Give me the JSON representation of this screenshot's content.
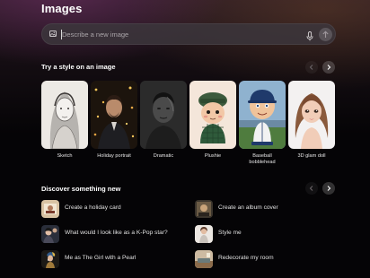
{
  "page": {
    "title": "Images"
  },
  "prompt": {
    "placeholder": "Describe a new image"
  },
  "styles_section": {
    "heading": "Try a style on an image",
    "items": [
      {
        "label": "Sketch"
      },
      {
        "label": "Holiday portrait"
      },
      {
        "label": "Dramatic"
      },
      {
        "label": "Plushie"
      },
      {
        "label": "Baseball bobblehead"
      },
      {
        "label": "3D glam doll"
      }
    ]
  },
  "discover_section": {
    "heading": "Discover something new",
    "items": [
      {
        "label": "Create a holiday card"
      },
      {
        "label": "Create an album cover"
      },
      {
        "label": "What would I look like as a K-Pop star?"
      },
      {
        "label": "Style me"
      },
      {
        "label": "Me as The Girl with a Pearl"
      },
      {
        "label": "Redecorate my room"
      }
    ]
  },
  "icons": {
    "image": "image-icon",
    "mic": "microphone-icon",
    "send": "arrow-up-icon",
    "prev": "chevron-left-icon",
    "next": "chevron-right-icon"
  }
}
